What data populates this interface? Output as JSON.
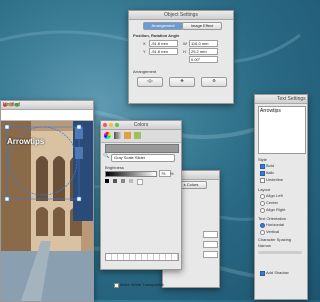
{
  "windows": {
    "object_settings": {
      "title": "Object Settings",
      "tabs": [
        "Arrangement",
        "Image Effect"
      ],
      "section_title": "Position, Rotation Angle",
      "x_label": "X",
      "x_value": "-51.6 mm",
      "y_label": "Y",
      "y_value": "-51.6 mm",
      "w_label": "W",
      "w_value": "116.0 mm",
      "h_label": "H",
      "h_value": "25.2 mm",
      "angle_value": "0.00°",
      "arrangement_label": "Arrangement"
    },
    "document": {
      "title": "Untitled",
      "curved_text": "Arrowtips"
    },
    "colors": {
      "title": "Colors",
      "mode": "Gray Scale Slider",
      "brightness_label": "Brightness",
      "brightness_value": "75",
      "brightness_unit": "%",
      "make_white_transparent": "Make White Transparent",
      "behind_tab": "s Colors"
    },
    "text_settings": {
      "title": "Text Settings",
      "text_content": "Arrowtips",
      "style_label": "Style",
      "style_options": [
        "Bold",
        "Italic",
        "Underline"
      ],
      "layout_label": "Layout",
      "layout_options": [
        "Align Left",
        "Center",
        "Align Right"
      ],
      "orientation_label": "Text Orientation",
      "orientation_options": [
        "Horizontal",
        "Vertical"
      ],
      "spacing_label": "Character Spacing",
      "spacing_value": "Narrow",
      "shadow_label": "Add Shadow"
    }
  },
  "colors_accent": {
    "selection": "#3a7bd5",
    "title_red": "#ee5a52"
  }
}
